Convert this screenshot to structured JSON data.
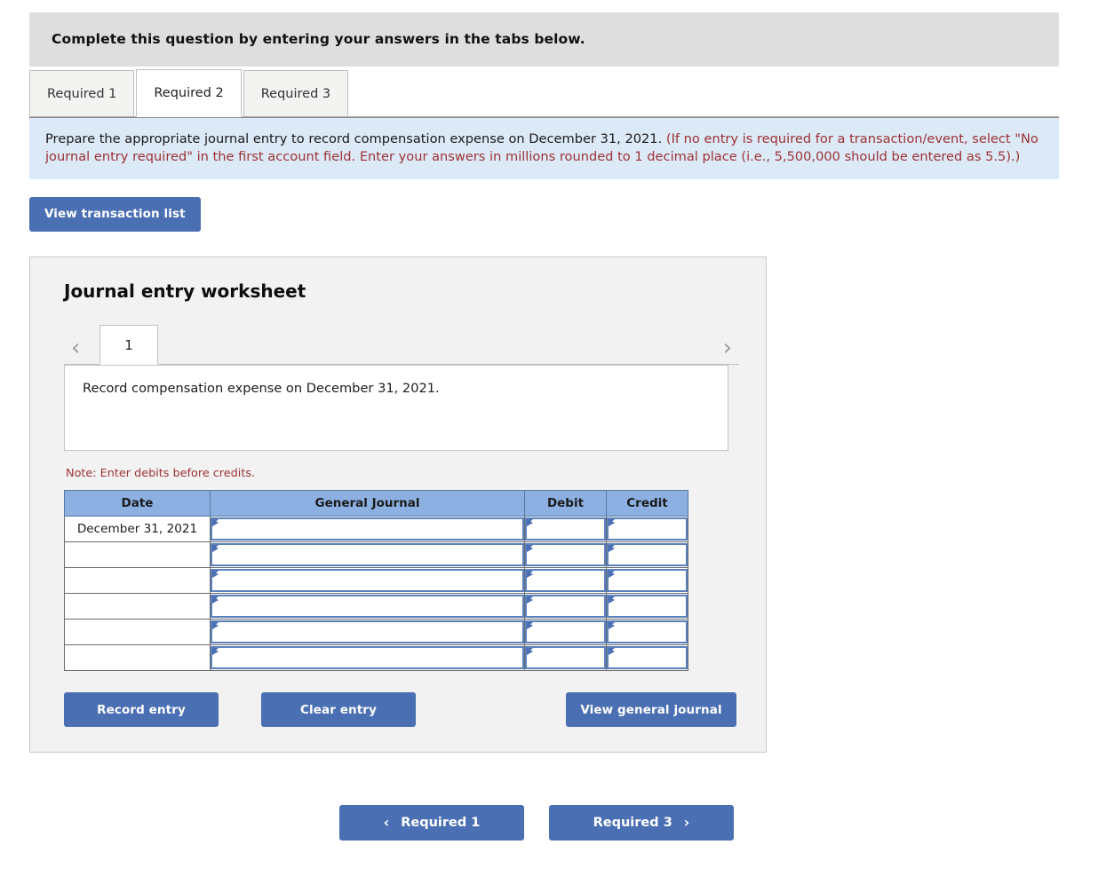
{
  "banner": {
    "text": "Complete this question by entering your answers in the tabs below."
  },
  "tabs": [
    {
      "label": "Required 1",
      "active": false
    },
    {
      "label": "Required 2",
      "active": true
    },
    {
      "label": "Required 3",
      "active": false
    }
  ],
  "instructions": {
    "lead": "Prepare the appropriate journal entry to record compensation expense on December 31, 2021.",
    "hint": "(If no entry is required for a transaction/event, select \"No journal entry required\" in the first account field. Enter your answers in millions rounded to 1 decimal place (i.e., 5,500,000 should be entered as 5.5).)"
  },
  "toolbar": {
    "view_transaction_list_label": "View transaction list"
  },
  "worksheet": {
    "title": "Journal entry worksheet",
    "pager": {
      "prev_icon": "chevron-left-icon",
      "next_icon": "chevron-right-icon",
      "prev_glyph": "‹",
      "next_glyph": "›",
      "current_page": "1"
    },
    "description": "Record compensation expense on December 31, 2021.",
    "note": "Note: Enter debits before credits.",
    "table": {
      "headers": [
        "Date",
        "General Journal",
        "Debit",
        "Credit"
      ],
      "rows": [
        {
          "date": "December 31, 2021",
          "general_journal": "",
          "debit": "",
          "credit": ""
        },
        {
          "date": "",
          "general_journal": "",
          "debit": "",
          "credit": ""
        },
        {
          "date": "",
          "general_journal": "",
          "debit": "",
          "credit": ""
        },
        {
          "date": "",
          "general_journal": "",
          "debit": "",
          "credit": ""
        },
        {
          "date": "",
          "general_journal": "",
          "debit": "",
          "credit": ""
        },
        {
          "date": "",
          "general_journal": "",
          "debit": "",
          "credit": ""
        }
      ]
    },
    "actions": {
      "record_entry_label": "Record entry",
      "clear_entry_label": "Clear entry",
      "view_general_journal_label": "View general journal"
    }
  },
  "footer": {
    "prev_label": "Required 1",
    "prev_glyph": "‹",
    "next_label": "Required 3",
    "next_glyph": "›"
  },
  "colors": {
    "accent_blue": "#4a6fb3",
    "banner_gray": "#dedede",
    "instruction_blue": "#dce9f7",
    "table_header_blue": "#8cb0e2",
    "hint_red": "#9d3232",
    "panel_gray": "#f2f2f2"
  }
}
